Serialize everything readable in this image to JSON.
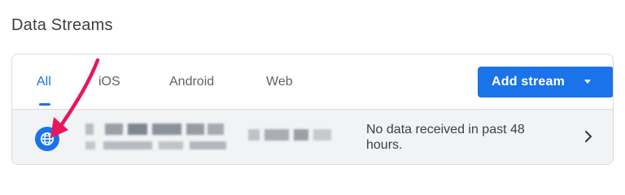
{
  "page": {
    "title": "Data Streams"
  },
  "tabs": [
    {
      "label": "All",
      "active": true
    },
    {
      "label": "iOS",
      "active": false
    },
    {
      "label": "Android",
      "active": false
    },
    {
      "label": "Web",
      "active": false
    }
  ],
  "toolbar": {
    "add_stream_label": "Add stream"
  },
  "streams": [
    {
      "icon": "globe-icon",
      "status": "No data received in past 48 hours."
    }
  ],
  "colors": {
    "accent": "#1a73e8",
    "annotation_arrow": "#e8175d",
    "row_bg": "#f1f3f4"
  }
}
